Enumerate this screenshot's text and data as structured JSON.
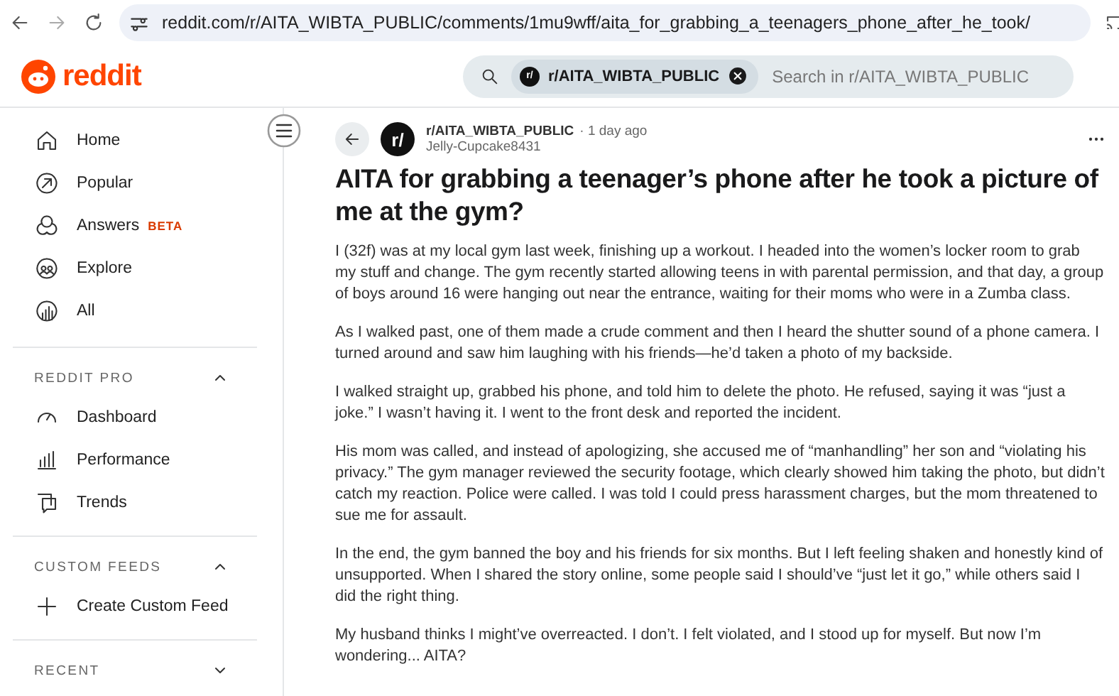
{
  "browser": {
    "url": "reddit.com/r/AITA_WIBTA_PUBLIC/comments/1mu9wff/aita_for_grabbing_a_teenagers_phone_after_he_took/"
  },
  "header": {
    "logo": "reddit",
    "search": {
      "chip_icon": "r/",
      "chip": "r/AITA_WIBTA_PUBLIC",
      "placeholder": "Search in r/AITA_WIBTA_PUBLIC"
    }
  },
  "sidebar": {
    "items": [
      {
        "label": "Home"
      },
      {
        "label": "Popular"
      },
      {
        "label": "Answers",
        "badge": "BETA"
      },
      {
        "label": "Explore"
      },
      {
        "label": "All"
      }
    ],
    "sections": [
      {
        "title": "REDDIT PRO",
        "expanded": true,
        "items": [
          {
            "label": "Dashboard"
          },
          {
            "label": "Performance"
          },
          {
            "label": "Trends"
          }
        ]
      },
      {
        "title": "CUSTOM FEEDS",
        "expanded": true,
        "items": [
          {
            "label": "Create Custom Feed"
          }
        ]
      },
      {
        "title": "RECENT",
        "expanded": false
      }
    ]
  },
  "post": {
    "avatar": "r/",
    "subreddit": "r/AITA_WIBTA_PUBLIC",
    "time": "· 1 day ago",
    "author": "Jelly-Cupcake8431",
    "title": "AITA for grabbing a teenager’s phone after he took a picture of me at the gym?",
    "paragraphs": [
      "I (32f) was at my local gym last week, finishing up a workout. I headed into the women’s locker room to grab my stuff and change. The gym recently started allowing teens in with parental permission, and that day, a group of boys around 16 were hanging out near the entrance, waiting for their moms who were in a Zumba class.",
      "As I walked past, one of them made a crude comment and then I heard the shutter sound of a phone camera. I turned around and saw him laughing with his friends—he’d taken a photo of my backside.",
      "I walked straight up, grabbed his phone, and told him to delete the photo. He refused, saying it was “just a joke.” I wasn’t having it. I went to the front desk and reported the incident.",
      "His mom was called, and instead of apologizing, she accused me of “manhandling” her son and “violating his privacy.” The gym manager reviewed the security footage, which clearly showed him taking the photo, but didn’t catch my reaction. Police were called. I was told I could press harassment charges, but the mom threatened to sue me for assault.",
      "In the end, the gym banned the boy and his friends for six months. But I left feeling shaken and honestly kind of unsupported. When I shared the story online, some people said I should’ve “just let it go,” while others said I did the right thing.",
      "My husband thinks I might’ve overreacted. I don’t. I felt violated, and I stood up for myself. But now I’m wondering... AITA?"
    ]
  }
}
